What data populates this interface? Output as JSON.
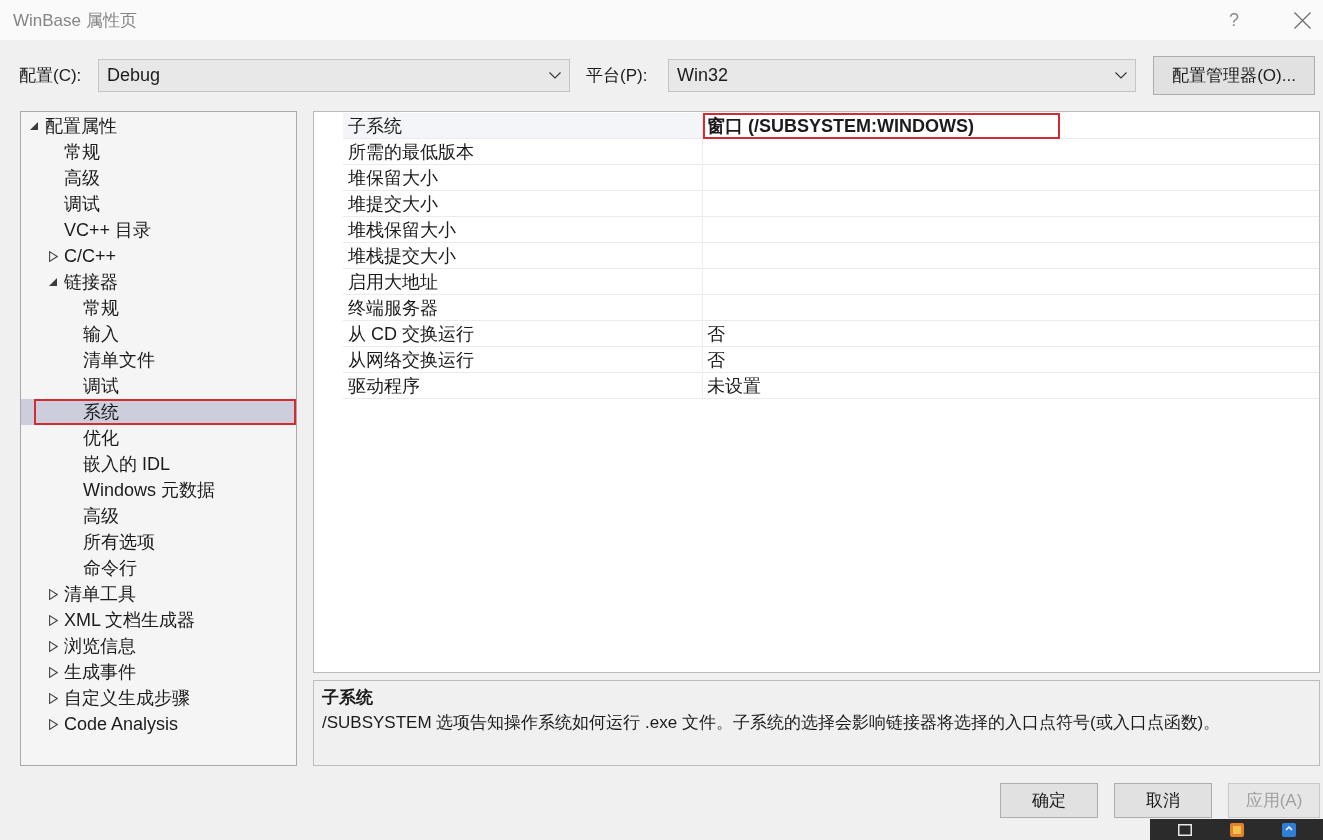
{
  "window": {
    "title": "WinBase 属性页",
    "help_button": "?"
  },
  "toolbar": {
    "configuration": {
      "label": "配置(C):",
      "value": "Debug"
    },
    "platform": {
      "label": "平台(P):",
      "value": "Win32"
    },
    "manager_button": "配置管理器(O)..."
  },
  "tree": [
    {
      "label": "配置属性",
      "kind": "node",
      "expanded": true,
      "selected": false,
      "children": [
        {
          "label": "常规",
          "kind": "leaf",
          "selected": false
        },
        {
          "label": "高级",
          "kind": "leaf",
          "selected": false
        },
        {
          "label": "调试",
          "kind": "leaf",
          "selected": false
        },
        {
          "label": "VC++ 目录",
          "kind": "leaf",
          "selected": false
        },
        {
          "label": "C/C++",
          "kind": "node",
          "expanded": false,
          "selected": false
        },
        {
          "label": "链接器",
          "kind": "node",
          "expanded": true,
          "selected": false,
          "children": [
            {
              "label": "常规",
              "kind": "leaf",
              "selected": false
            },
            {
              "label": "输入",
              "kind": "leaf",
              "selected": false
            },
            {
              "label": "清单文件",
              "kind": "leaf",
              "selected": false
            },
            {
              "label": "调试",
              "kind": "leaf",
              "selected": false
            },
            {
              "label": "系统",
              "kind": "leaf",
              "selected": true,
              "annotated": true
            },
            {
              "label": "优化",
              "kind": "leaf",
              "selected": false
            },
            {
              "label": "嵌入的 IDL",
              "kind": "leaf",
              "selected": false
            },
            {
              "label": "Windows 元数据",
              "kind": "leaf",
              "selected": false
            },
            {
              "label": "高级",
              "kind": "leaf",
              "selected": false
            },
            {
              "label": "所有选项",
              "kind": "leaf",
              "selected": false
            },
            {
              "label": "命令行",
              "kind": "leaf",
              "selected": false
            }
          ]
        },
        {
          "label": "清单工具",
          "kind": "node",
          "expanded": false,
          "selected": false
        },
        {
          "label": "XML 文档生成器",
          "kind": "node",
          "expanded": false,
          "selected": false
        },
        {
          "label": "浏览信息",
          "kind": "node",
          "expanded": false,
          "selected": false
        },
        {
          "label": "生成事件",
          "kind": "node",
          "expanded": false,
          "selected": false
        },
        {
          "label": "自定义生成步骤",
          "kind": "node",
          "expanded": false,
          "selected": false
        },
        {
          "label": "Code Analysis",
          "kind": "node",
          "expanded": false,
          "selected": false
        }
      ]
    }
  ],
  "properties": {
    "rows": [
      {
        "name": "子系统",
        "value": "窗口 (/SUBSYSTEM:WINDOWS)",
        "modified": true,
        "selected": true,
        "annotated": true
      },
      {
        "name": "所需的最低版本",
        "selected": false
      },
      {
        "name": "堆保留大小",
        "selected": false
      },
      {
        "name": "堆提交大小",
        "selected": false
      },
      {
        "name": "堆栈保留大小",
        "selected": false
      },
      {
        "name": "堆栈提交大小",
        "selected": false
      },
      {
        "name": "启用大地址",
        "selected": false
      },
      {
        "name": "终端服务器",
        "selected": false
      },
      {
        "name": "从 CD 交换运行",
        "value": "否",
        "modified": false,
        "selected": false
      },
      {
        "name": "从网络交换运行",
        "value": "否",
        "modified": false,
        "selected": false
      },
      {
        "name": "驱动程序",
        "value": "未设置",
        "modified": false,
        "selected": false
      }
    ]
  },
  "description": {
    "title": "子系统",
    "text": "/SUBSYSTEM 选项告知操作系统如何运行 .exe 文件。子系统的选择会影响链接器将选择的入口点符号(或入口点函数)。"
  },
  "buttons": [
    {
      "label": "确定",
      "disabled": false
    },
    {
      "label": "取消",
      "disabled": false
    },
    {
      "label": "应用(A)",
      "disabled": true
    }
  ]
}
